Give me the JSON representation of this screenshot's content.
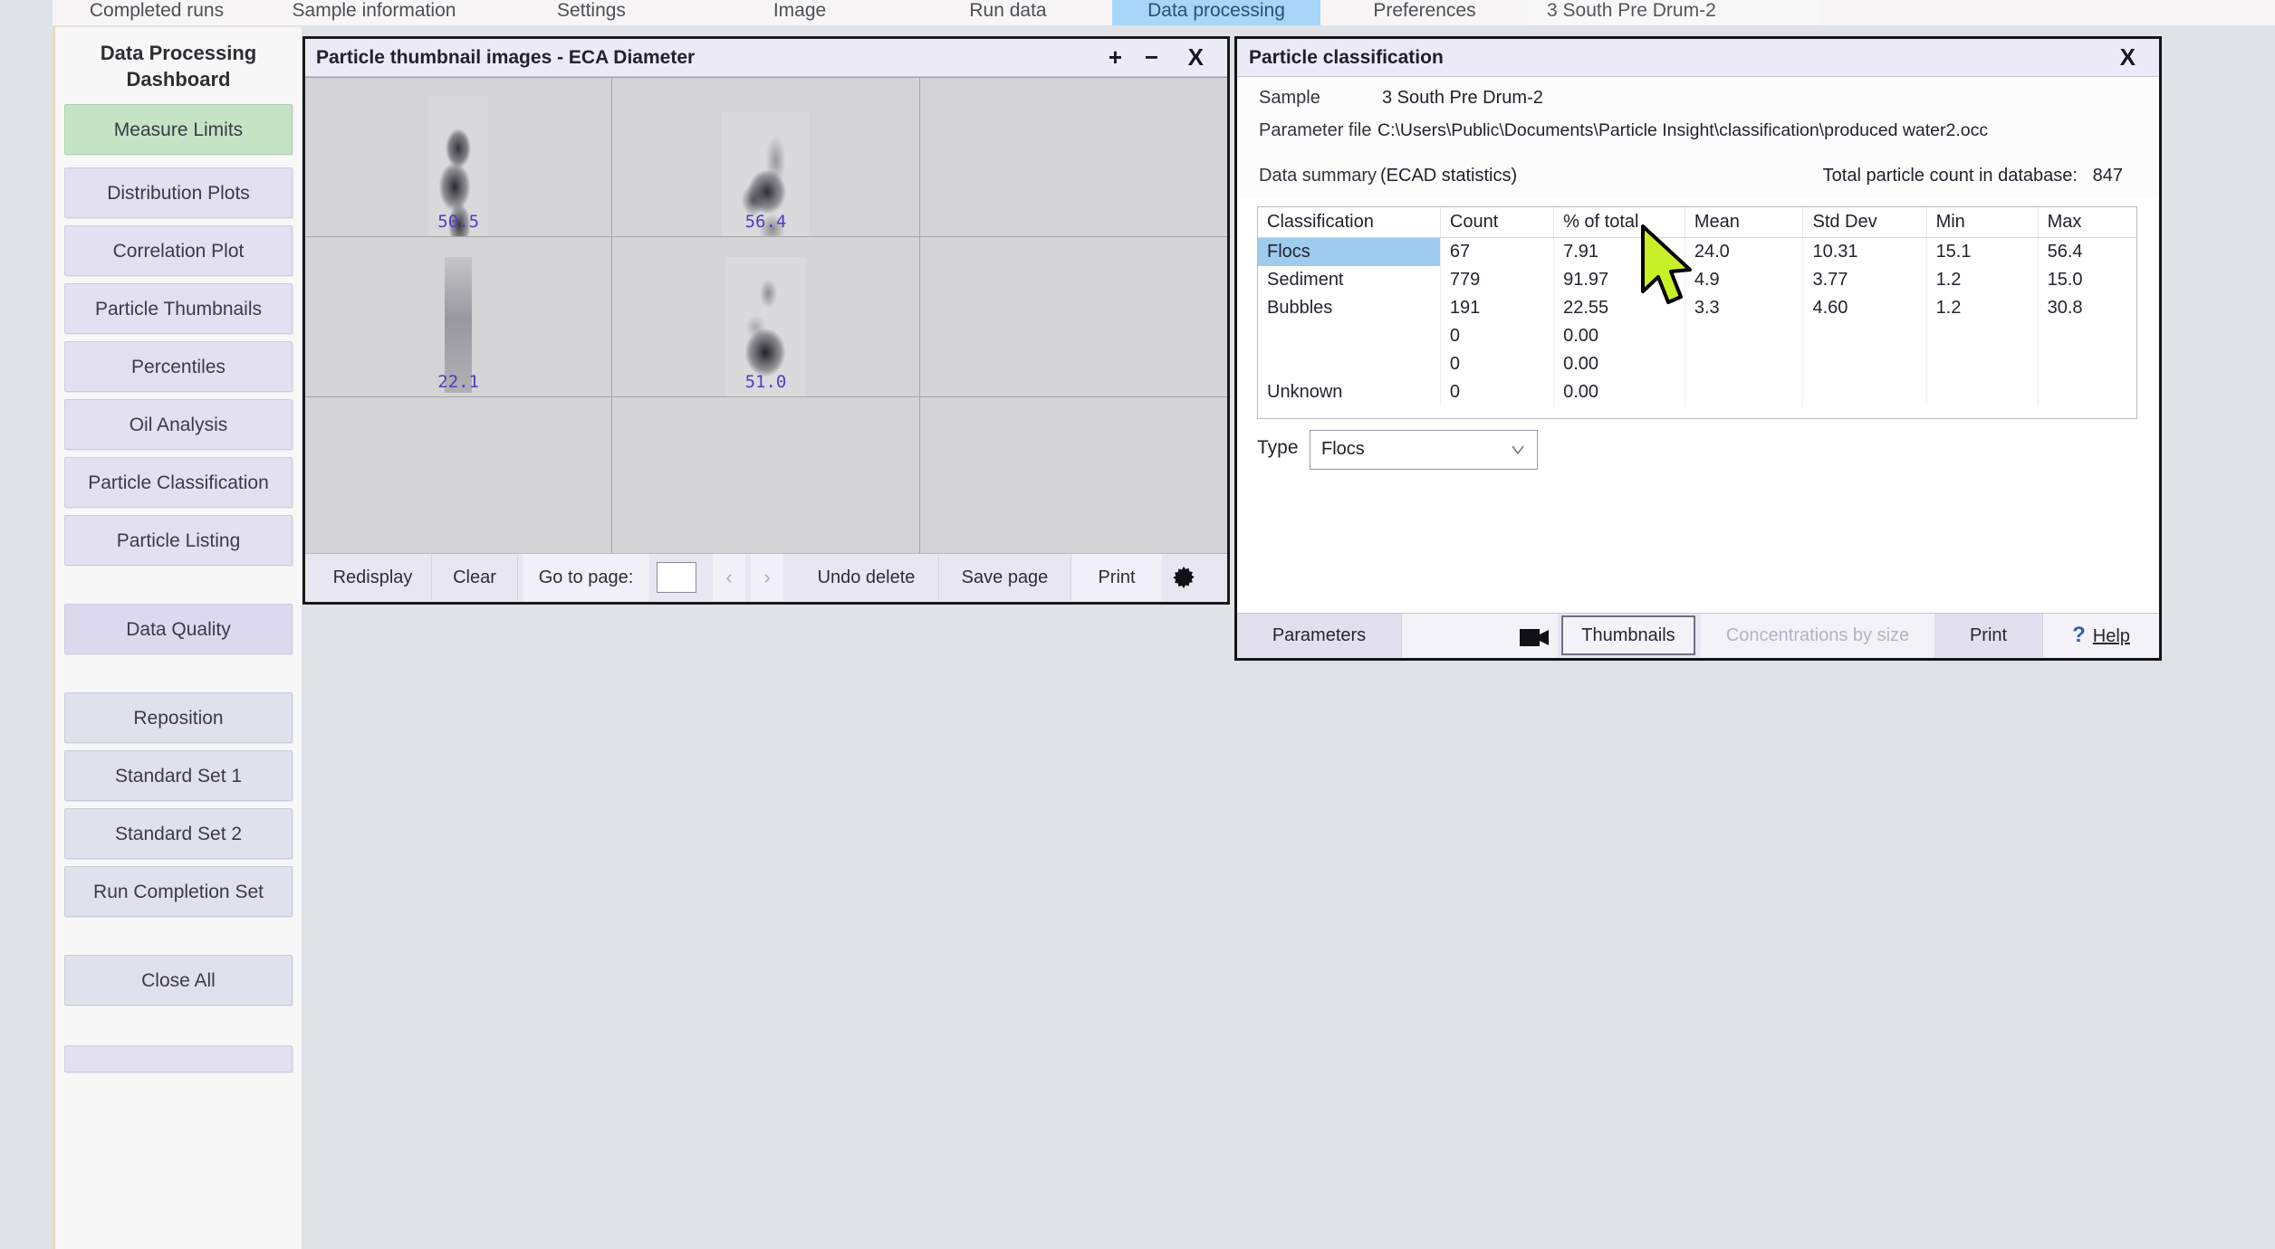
{
  "tabs": [
    {
      "label": "Completed runs"
    },
    {
      "label": "Sample information"
    },
    {
      "label": "Settings"
    },
    {
      "label": "Image"
    },
    {
      "label": "Run data"
    },
    {
      "label": "Data processing"
    },
    {
      "label": "Preferences"
    },
    {
      "label": "3 South Pre Drum-2"
    }
  ],
  "sidebar": {
    "title_line1": "Data Processing",
    "title_line2": "Dashboard",
    "items": [
      {
        "label": "Measure Limits",
        "style": "green"
      },
      {
        "label": "Distribution Plots",
        "style": "lav"
      },
      {
        "label": "Correlation Plot",
        "style": "lav"
      },
      {
        "label": "Particle Thumbnails",
        "style": "lav"
      },
      {
        "label": "Percentiles",
        "style": "lav"
      },
      {
        "label": "Oil Analysis",
        "style": "lav"
      },
      {
        "label": "Particle Classification",
        "style": "lav"
      },
      {
        "label": "Particle Listing",
        "style": "lav"
      },
      {
        "label": "Data Quality",
        "style": "lav2"
      },
      {
        "label": "Reposition",
        "style": "grey"
      },
      {
        "label": "Standard Set 1",
        "style": "grey"
      },
      {
        "label": "Standard Set 2",
        "style": "grey"
      },
      {
        "label": "Run Completion Set",
        "style": "grey"
      },
      {
        "label": "Close All",
        "style": "grey"
      }
    ]
  },
  "thumbnail_window": {
    "title": "Particle thumbnail images - ECA Diameter",
    "zoom_in": "+",
    "zoom_out": "−",
    "close": "X",
    "thumbnails": [
      {
        "value": "50.5"
      },
      {
        "value": "56.4"
      },
      {
        "value": ""
      },
      {
        "value": "22.1"
      },
      {
        "value": "51.0"
      },
      {
        "value": ""
      },
      {
        "value": ""
      },
      {
        "value": ""
      },
      {
        "value": ""
      }
    ],
    "footer": {
      "redisplay": "Redisplay",
      "clear": "Clear",
      "goto_page_label": "Go to page:",
      "page_value": "",
      "prev": "‹",
      "next": "›",
      "undo_delete": "Undo delete",
      "save_page": "Save page",
      "print": "Print"
    }
  },
  "classification_window": {
    "title": "Particle classification",
    "close": "X",
    "sample_label": "Sample",
    "sample_value": "3 South Pre Drum-2",
    "parameter_file_label": "Parameter file",
    "parameter_file_value": "C:\\Users\\Public\\Documents\\Particle Insight\\classification\\produced water2.occ",
    "data_summary_label": "Data summary",
    "data_summary_unit": "(ECAD statistics)",
    "total_count_label": "Total particle count in database:",
    "total_count_value": "847",
    "table": {
      "headers": [
        "Classification",
        "Count",
        "% of total",
        "Mean",
        "Std Dev",
        "Min",
        "Max"
      ],
      "rows": [
        {
          "classification": "Flocs",
          "count": "67",
          "pct": "7.91",
          "mean": "24.0",
          "std": "10.31",
          "min": "15.1",
          "max": "56.4",
          "selected": true
        },
        {
          "classification": "Sediment",
          "count": "779",
          "pct": "91.97",
          "mean": "4.9",
          "std": "3.77",
          "min": "1.2",
          "max": "15.0",
          "selected": false
        },
        {
          "classification": "Bubbles",
          "count": "191",
          "pct": "22.55",
          "mean": "3.3",
          "std": "4.60",
          "min": "1.2",
          "max": "30.8",
          "selected": false
        },
        {
          "classification": "",
          "count": "0",
          "pct": "0.00",
          "mean": "",
          "std": "",
          "min": "",
          "max": "",
          "selected": false
        },
        {
          "classification": "",
          "count": "0",
          "pct": "0.00",
          "mean": "",
          "std": "",
          "min": "",
          "max": "",
          "selected": false
        },
        {
          "classification": "Unknown",
          "count": "0",
          "pct": "0.00",
          "mean": "",
          "std": "",
          "min": "",
          "max": "",
          "selected": false
        }
      ]
    },
    "type_label": "Type",
    "type_value": "Flocs",
    "toolbar": {
      "parameters": "Parameters",
      "thumbnails": "Thumbnails",
      "concentrations": "Concentrations by size",
      "print": "Print",
      "help": "Help",
      "help_mark": "?"
    }
  },
  "colors": {
    "accent_tab": "#a8d5f8",
    "selected_row": "#9fcbef",
    "measure_limits": "#c6e3c6",
    "sidebar_button": "#e3e0f2",
    "thumb_label": "#4a3fc0",
    "cursor": "#c8f028"
  }
}
